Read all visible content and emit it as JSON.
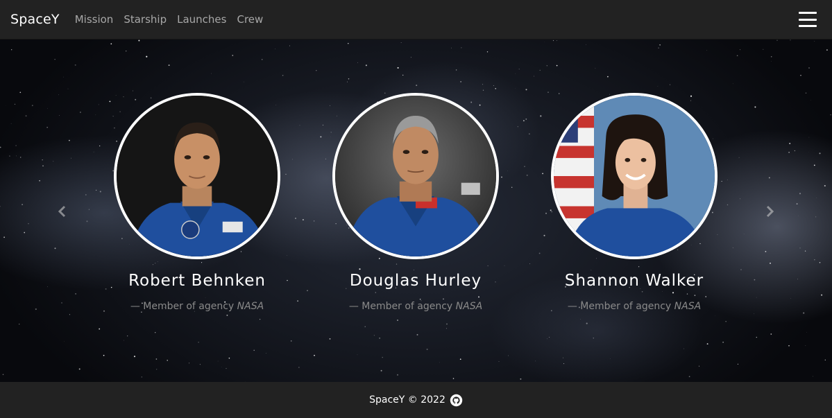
{
  "navbar": {
    "brand": "SpaceY",
    "links": [
      "Mission",
      "Starship",
      "Launches",
      "Crew"
    ],
    "menu_icon": "hamburger-icon"
  },
  "carousel": {
    "prev_icon": "chevron-left-icon",
    "next_icon": "chevron-right-icon",
    "crew": [
      {
        "name": "Robert Behnken",
        "role_prefix": "— Member of agency ",
        "agency": "NASA"
      },
      {
        "name": "Douglas Hurley",
        "role_prefix": "— Member of agency ",
        "agency": "NASA"
      },
      {
        "name": "Shannon Walker",
        "role_prefix": "— Member of agency ",
        "agency": "NASA"
      }
    ]
  },
  "footer": {
    "text": "SpaceY © 2022",
    "icon": "github-icon"
  },
  "colors": {
    "navbar_bg": "#222222",
    "nav_link": "#a8a8a8",
    "suit_blue": "#1f4f9e",
    "role_text": "#8a8a8a"
  }
}
